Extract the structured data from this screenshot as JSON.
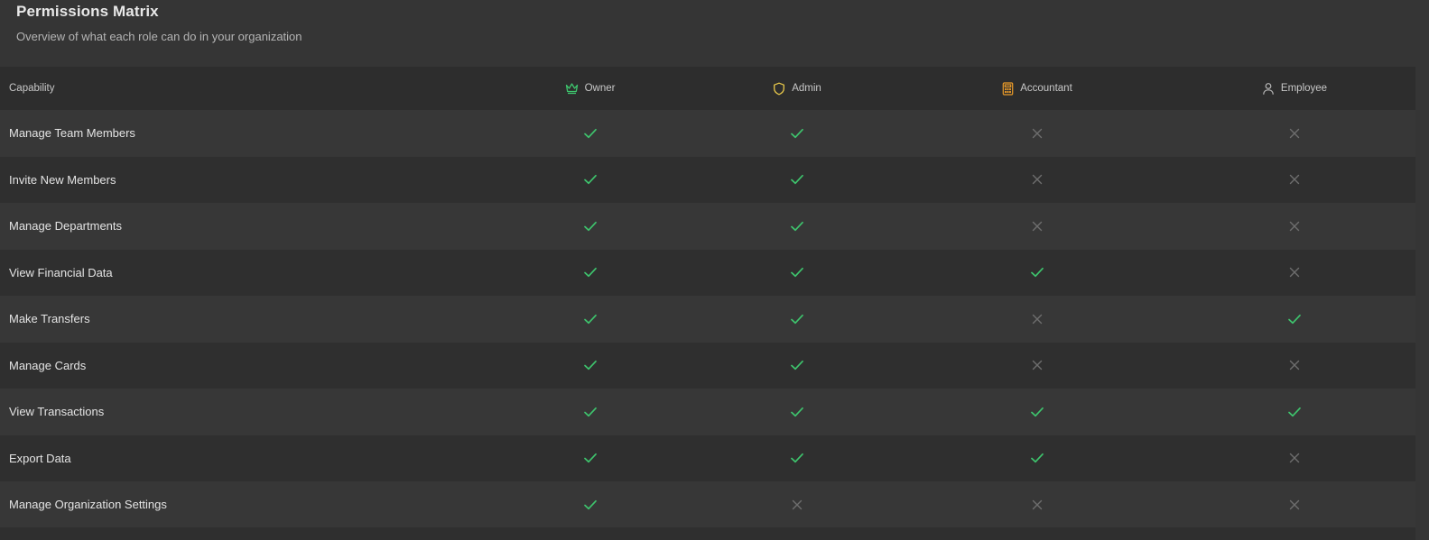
{
  "header": {
    "title": "Permissions Matrix",
    "subtitle": "Overview of what each role can do in your organization"
  },
  "table": {
    "capability_header": "Capability",
    "roles": [
      {
        "label": "Owner",
        "icon": "crown-icon",
        "color": "#3ec46d"
      },
      {
        "label": "Admin",
        "icon": "shield-icon",
        "color": "#e8c84a"
      },
      {
        "label": "Accountant",
        "icon": "calculator-icon",
        "color": "#e89a2a"
      },
      {
        "label": "Employee",
        "icon": "user-icon",
        "color": "#b8b8b8"
      }
    ],
    "rows": [
      {
        "capability": "Manage Team Members",
        "access": [
          true,
          true,
          false,
          false
        ]
      },
      {
        "capability": "Invite New Members",
        "access": [
          true,
          true,
          false,
          false
        ]
      },
      {
        "capability": "Manage Departments",
        "access": [
          true,
          true,
          false,
          false
        ]
      },
      {
        "capability": "View Financial Data",
        "access": [
          true,
          true,
          true,
          false
        ]
      },
      {
        "capability": "Make Transfers",
        "access": [
          true,
          true,
          false,
          true
        ]
      },
      {
        "capability": "Manage Cards",
        "access": [
          true,
          true,
          false,
          false
        ]
      },
      {
        "capability": "View Transactions",
        "access": [
          true,
          true,
          true,
          true
        ]
      },
      {
        "capability": "Export Data",
        "access": [
          true,
          true,
          true,
          false
        ]
      },
      {
        "capability": "Manage Organization Settings",
        "access": [
          true,
          false,
          false,
          false
        ]
      }
    ]
  },
  "colors": {
    "check": "#3ec46d",
    "cross": "#6e6e6e"
  }
}
